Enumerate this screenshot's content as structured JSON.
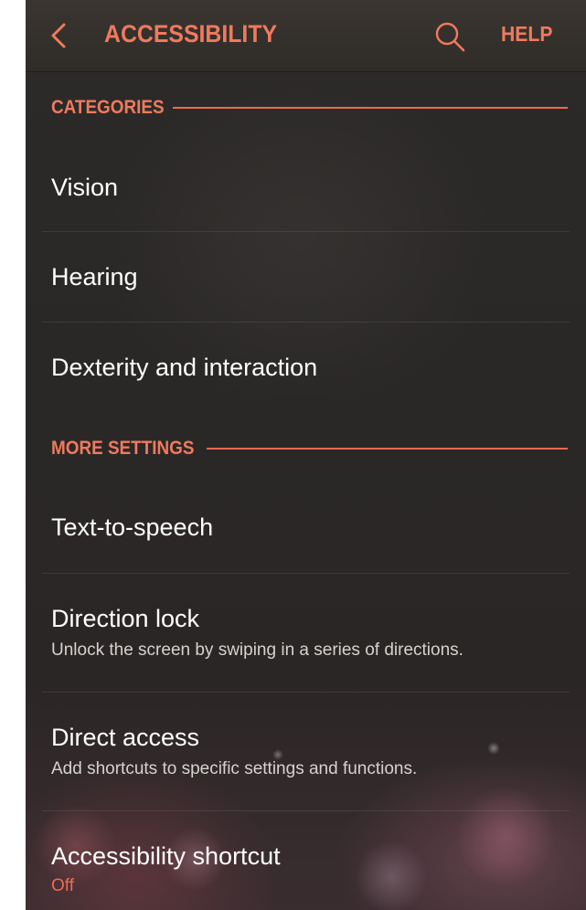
{
  "appbar": {
    "title": "ACCESSIBILITY",
    "back_icon": "chevron-left-icon",
    "search_icon": "search-icon",
    "help_label": "HELP"
  },
  "colors": {
    "accent": "#f07a5e",
    "status_off": "#ef6b4f",
    "text_primary": "#ffffff",
    "text_secondary": "#d6d2ce"
  },
  "sections": {
    "categories": {
      "label": "CATEGORIES",
      "items": [
        {
          "title": "Vision"
        },
        {
          "title": "Hearing"
        },
        {
          "title": "Dexterity and interaction"
        }
      ]
    },
    "more_settings": {
      "label": "MORE SETTINGS",
      "items": [
        {
          "title": "Text-to-speech"
        },
        {
          "title": "Direction lock",
          "subtitle": "Unlock the screen by swiping in a series of directions."
        },
        {
          "title": "Direct access",
          "subtitle": "Add shortcuts to specific settings and functions."
        },
        {
          "title": "Accessibility shortcut",
          "status": "Off"
        }
      ]
    }
  }
}
